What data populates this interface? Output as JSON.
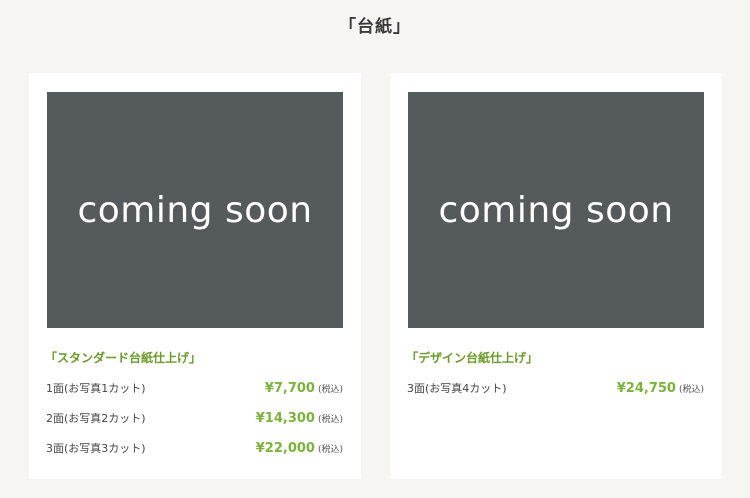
{
  "page": {
    "title": "「台紙」"
  },
  "cards": [
    {
      "placeholder_text": "coming soon",
      "name": "「スタンダード台紙仕上げ」",
      "options": [
        {
          "label": "1面(お写真1カット)",
          "price": "¥7,700",
          "tax": "(税込)"
        },
        {
          "label": "2面(お写真2カット)",
          "price": "¥14,300",
          "tax": "(税込)"
        },
        {
          "label": "3面(お写真3カット)",
          "price": "¥22,000",
          "tax": "(税込)"
        }
      ]
    },
    {
      "placeholder_text": "coming soon",
      "name": "「デザイン台紙仕上げ」",
      "options": [
        {
          "label": "3面(お写真4カット)",
          "price": "¥24,750",
          "tax": "(税込)"
        }
      ]
    }
  ],
  "colors": {
    "background": "#f6f5f1",
    "placeholder": "#555b5d",
    "product_name": "#6a9a2a",
    "price": "#7bb33a"
  }
}
